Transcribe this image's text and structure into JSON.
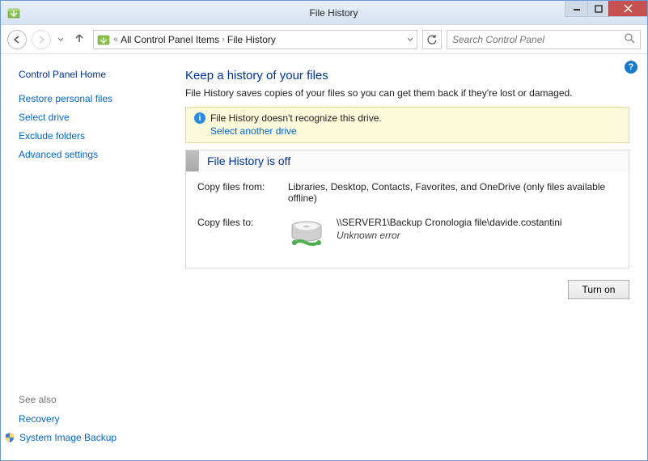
{
  "window": {
    "title": "File History"
  },
  "nav": {
    "crumb1": "All Control Panel Items",
    "crumb2": "File History",
    "search_placeholder": "Search Control Panel"
  },
  "sidebar": {
    "home": "Control Panel Home",
    "links": {
      "restore": "Restore personal files",
      "select_drive": "Select drive",
      "exclude": "Exclude folders",
      "advanced": "Advanced settings"
    },
    "see_also": "See also",
    "recovery": "Recovery",
    "sib": "System Image Backup"
  },
  "main": {
    "title": "Keep a history of your files",
    "subtitle": "File History saves copies of your files so you can get them back if they're lost or damaged.",
    "notice": {
      "msg": "File History doesn't recognize this drive.",
      "link": "Select another drive"
    },
    "status": {
      "title": "File History is off",
      "from_label": "Copy files from:",
      "from_value": "Libraries, Desktop, Contacts, Favorites, and OneDrive (only files available offline)",
      "to_label": "Copy files to:",
      "to_path": "\\\\SERVER1\\Backup Cronologia file\\davide.costantini",
      "to_error": "Unknown error"
    },
    "button": "Turn on"
  }
}
